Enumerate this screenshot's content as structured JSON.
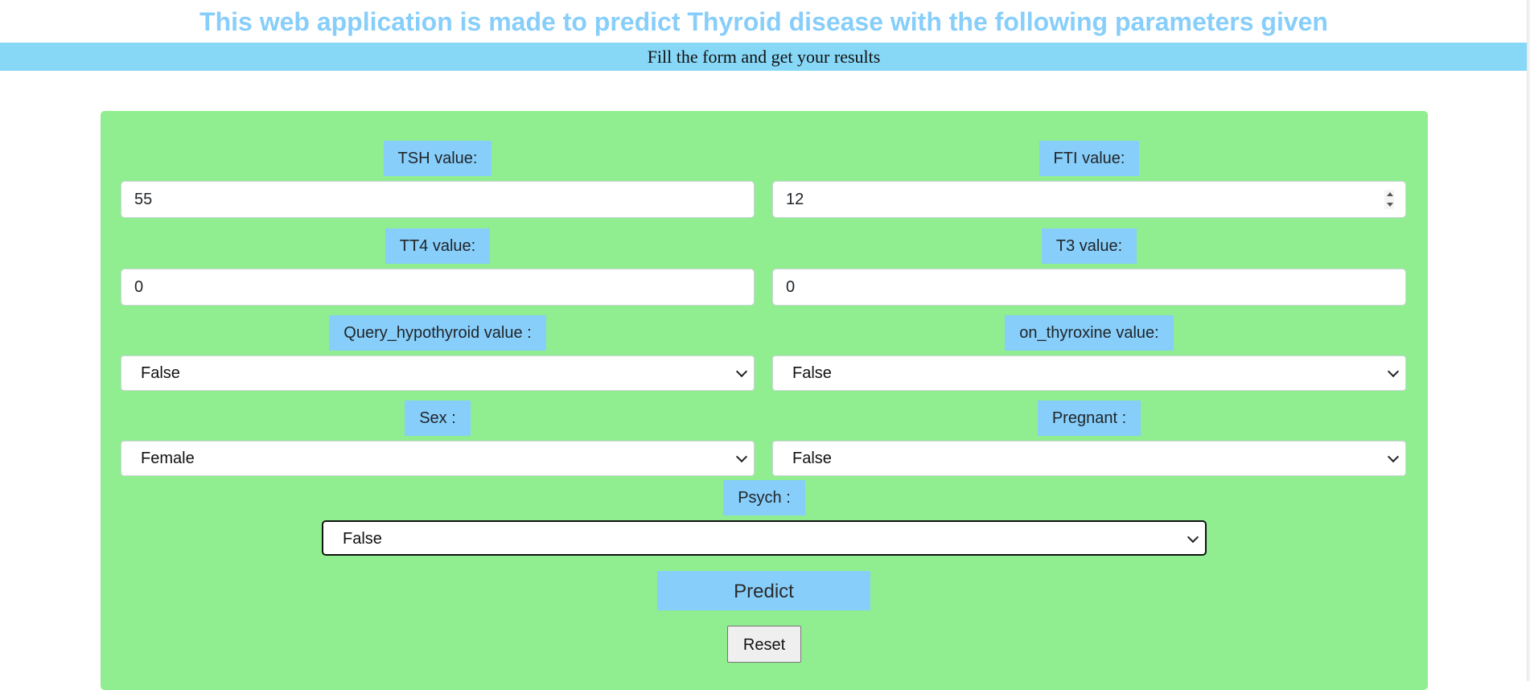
{
  "header": {
    "title": "This web application is made to predict Thyroid disease with the following parameters given",
    "subtitle": "Fill the form and get your results"
  },
  "colors": {
    "title": "#87cefa",
    "banner": "#87d8f7",
    "panel": "#90ee90",
    "label_bg": "#87cefa"
  },
  "form": {
    "tsh": {
      "label": "TSH value:",
      "value": "55"
    },
    "fti": {
      "label": "FTI value:",
      "value": "12"
    },
    "tt4": {
      "label": "TT4 value:",
      "value": "0"
    },
    "t3": {
      "label": "T3 value:",
      "value": "0"
    },
    "query_hypothyroid": {
      "label": "Query_hypothyroid value :",
      "selected": "False"
    },
    "on_thyroxine": {
      "label": "on_thyroxine value:",
      "selected": "False"
    },
    "sex": {
      "label": "Sex :",
      "selected": "Female"
    },
    "pregnant": {
      "label": "Pregnant :",
      "selected": "False"
    },
    "psych": {
      "label": "Psych :",
      "selected": "False"
    },
    "predict_label": "Predict",
    "reset_label": "Reset"
  },
  "icons": {
    "select_arrow": "chevron-down-icon",
    "number_spinner": "spinner-icon"
  }
}
